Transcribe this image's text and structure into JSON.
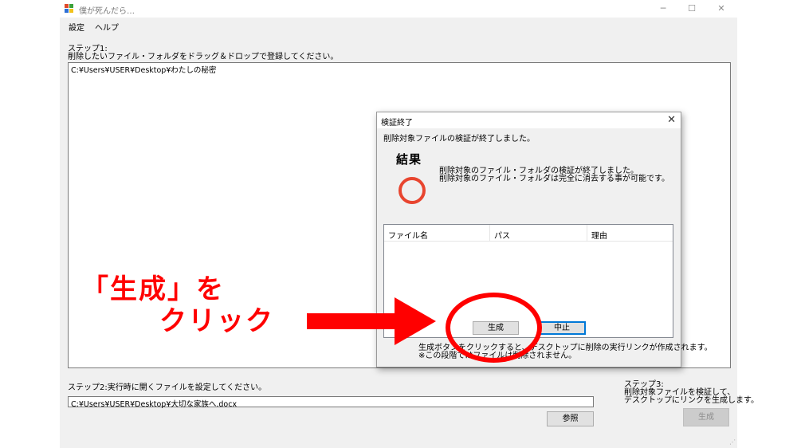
{
  "window": {
    "title": "僕が死んだら…",
    "controls": {
      "minimize": "─",
      "maximize": "☐",
      "close": "✕"
    }
  },
  "menu": {
    "settings": "設定",
    "help": "ヘルプ"
  },
  "step1": {
    "label": "ステップ1:",
    "instruction": "削除したいファイル・フォルダをドラッグ＆ドロップで登録してください。",
    "entries": [
      "C:¥Users¥USER¥Desktop¥わたしの秘密"
    ]
  },
  "step2": {
    "label": "ステップ2:実行時に開くファイルを設定してください。",
    "path": "C:¥Users¥USER¥Desktop¥大切な家族へ.docx",
    "browse_label": "参照"
  },
  "step3": {
    "line1": "ステップ3:",
    "line2": "削除対象ファイルを検証して、",
    "line3": "デスクトップにリンクを生成します。",
    "generate_label": "生成"
  },
  "dialog": {
    "title": "検証終了",
    "message": "削除対象ファイルの検証が終了しました。",
    "result_heading": "結果",
    "result_line1": "削除対象のファイル・フォルダの検証が終了しました。",
    "result_line2": "削除対象のファイル・フォルダは完全に消去する事が可能です。",
    "columns": [
      "ファイル名",
      "パス",
      "理由"
    ],
    "generate_label": "生成",
    "cancel_label": "中止",
    "footer_line1": "生成ボタンをクリックすると、デスクトップに削除の実行リンクが作成されます。",
    "footer_line2": "※この段階ではファイルは削除されません。"
  },
  "annotation": {
    "line1": "「生成」を",
    "line2": "クリック",
    "color": "#ff0000"
  },
  "colors": {
    "window_bg": "#f0f0f0",
    "focus_border": "#0078d7",
    "result_ok": "#e8452f"
  }
}
